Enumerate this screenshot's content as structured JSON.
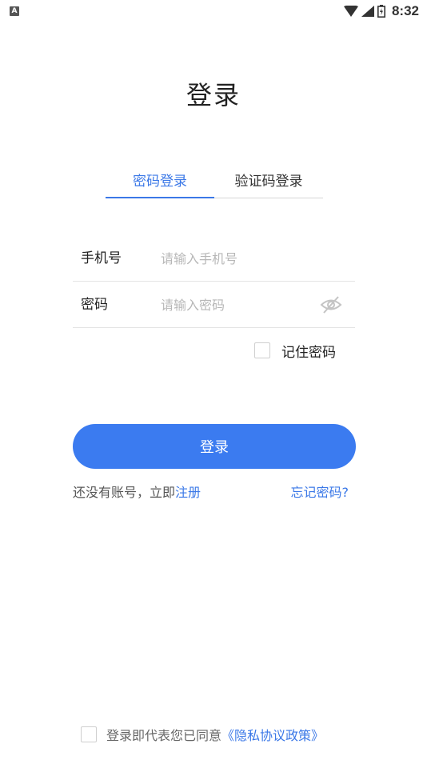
{
  "status_bar": {
    "app_icon_letter": "A",
    "time": "8:32"
  },
  "title": "登录",
  "tabs": [
    {
      "label": "密码登录",
      "active": true
    },
    {
      "label": "验证码登录",
      "active": false
    }
  ],
  "form": {
    "phone": {
      "label": "手机号",
      "placeholder": "请输入手机号",
      "value": ""
    },
    "password": {
      "label": "密码",
      "placeholder": "请输入密码",
      "value": ""
    }
  },
  "remember": {
    "label": "记住密码",
    "checked": false
  },
  "login_button": "登录",
  "register": {
    "prefix": "还没有账号，立即",
    "link": "注册"
  },
  "forgot": "忘记密码?",
  "agreement": {
    "text": "登录即代表您已同意",
    "link": "《隐私协议政策》",
    "checked": false
  },
  "colors": {
    "accent": "#3b7bf0",
    "link": "#3b78e7"
  },
  "icons": [
    "wifi-icon",
    "signal-icon",
    "battery-icon",
    "eye-off-icon",
    "checkbox-icon"
  ]
}
